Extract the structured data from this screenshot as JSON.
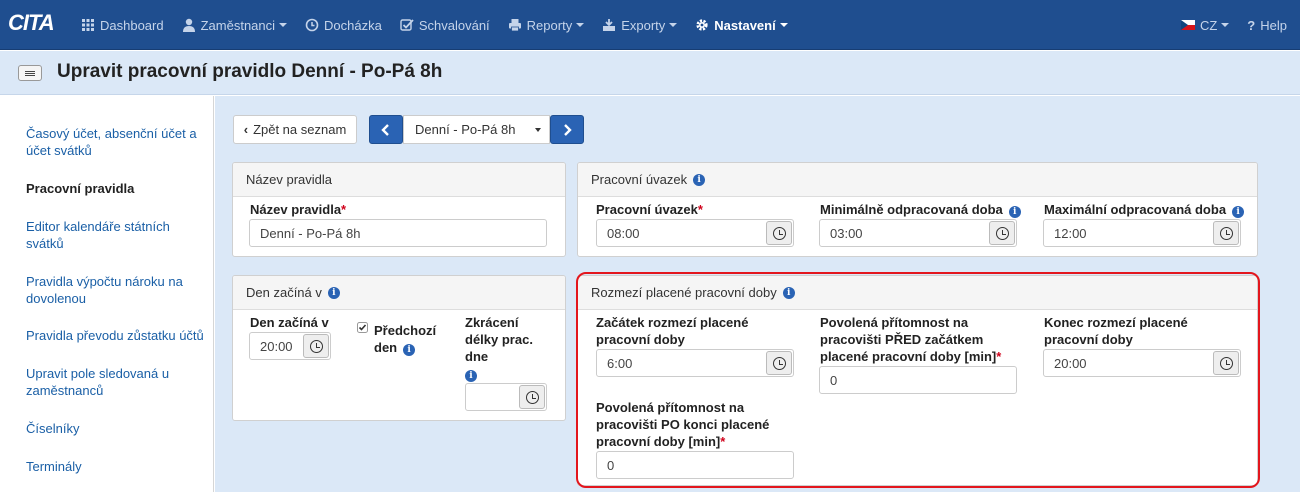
{
  "nav": {
    "logo": "CITA",
    "items": [
      {
        "label": "Dashboard",
        "icon": "dashboard-icon"
      },
      {
        "label": "Zaměstnanci",
        "icon": "user-icon",
        "caret": true
      },
      {
        "label": "Docházka",
        "icon": "clock-icon"
      },
      {
        "label": "Schvalování",
        "icon": "check-icon"
      },
      {
        "label": "Reporty",
        "icon": "print-icon",
        "caret": true
      },
      {
        "label": "Exporty",
        "icon": "export-icon",
        "caret": true
      },
      {
        "label": "Nastavení",
        "icon": "gear-icon",
        "caret": true,
        "active": true
      }
    ],
    "lang": "CZ",
    "help": "Help"
  },
  "page": {
    "title": "Upravit pracovní pravidlo Denní - Po-Pá 8h"
  },
  "sidebar": {
    "items": [
      "Časový účet, absenční účet a účet svátků",
      "Pracovní pravidla",
      "Editor kalendáře státních svátků",
      "Pravidla výpočtu nároku na dovolenou",
      "Pravidla převodu zůstatku účtů",
      "Upravit pole sledovaná u zaměstnanců",
      "Číselníky",
      "Terminály"
    ],
    "active": 1
  },
  "toolbar": {
    "back": "Zpět na seznam",
    "select": "Denní - Po-Pá 8h"
  },
  "panels": {
    "name": {
      "title": "Název pravidla",
      "label": "Název pravidla",
      "value": "Denní - Po-Pá 8h"
    },
    "uvazek": {
      "title": "Pracovní úvazek",
      "f1_label": "Pracovní úvazek",
      "f1_value": "08:00",
      "f2_label": "Minimálně odpracovaná doba",
      "f2_value": "03:00",
      "f3_label": "Maximální odpracovaná doba",
      "f3_value": "12:00"
    },
    "den": {
      "title": "Den začíná v",
      "f1_label": "Den začíná v",
      "f1_value": "20:00",
      "chk_label": "Předchozí den",
      "f3_label": "Zkrácení délky prac. dne",
      "f3_value": ""
    },
    "rozmezi": {
      "title": "Rozmezí placené pracovní doby",
      "f1_label": "Začátek rozmezí placené pracovní doby",
      "f1_value": "6:00",
      "f2_label": "Povolená přítomnost na pracovišti PŘED začátkem placené pracovní doby [min]",
      "f2_value": "0",
      "f3_label": "Konec rozmezí placené pracovní doby",
      "f3_value": "20:00",
      "f4_label": "Povolená přítomnost na pracovišti PO konci placené pracovní doby [min]",
      "f4_value": "0"
    }
  },
  "colors": {
    "navbar": "#1f4e8f",
    "accent": "#2a63b4",
    "highlight": "#e3161d",
    "background": "#dbe8f7"
  }
}
